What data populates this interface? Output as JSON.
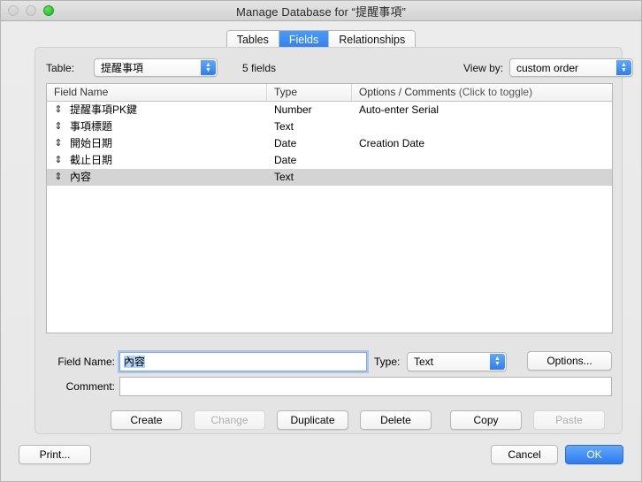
{
  "window": {
    "title": "Manage Database for “提醒事項”",
    "traffic_lights": [
      {
        "name": "close",
        "state": "disabled"
      },
      {
        "name": "minimize",
        "state": "disabled"
      },
      {
        "name": "zoom",
        "state": "enabled",
        "color": "#28c231"
      }
    ]
  },
  "tabs": [
    {
      "label": "Tables",
      "active": false
    },
    {
      "label": "Fields",
      "active": true
    },
    {
      "label": "Relationships",
      "active": false
    }
  ],
  "controls": {
    "table_label": "Table:",
    "table_value": "提醒事項",
    "field_count": "5 fields",
    "viewby_label": "View by:",
    "viewby_value": "custom order"
  },
  "list": {
    "headers": {
      "field_name": "Field Name",
      "type": "Type",
      "options": "Options / Comments",
      "options_hint": "(Click to toggle)"
    },
    "rows": [
      {
        "handle": "⇕",
        "name": "提醒事項PK鍵",
        "type": "Number",
        "options": "Auto-enter Serial",
        "selected": false
      },
      {
        "handle": "⇕",
        "name": "事項標題",
        "type": "Text",
        "options": "",
        "selected": false
      },
      {
        "handle": "⇕",
        "name": "開始日期",
        "type": "Date",
        "options": "Creation Date",
        "selected": false
      },
      {
        "handle": "⇕",
        "name": "截止日期",
        "type": "Date",
        "options": "",
        "selected": false
      },
      {
        "handle": "⇕",
        "name": "內容",
        "type": "Text",
        "options": "",
        "selected": true
      }
    ]
  },
  "form": {
    "fieldname_label": "Field Name:",
    "fieldname_value": "內容",
    "type_label": "Type:",
    "type_value": "Text",
    "options_button": "Options...",
    "comment_label": "Comment:",
    "comment_value": ""
  },
  "actions": [
    {
      "label": "Create",
      "enabled": true
    },
    {
      "label": "Change",
      "enabled": false
    },
    {
      "label": "Duplicate",
      "enabled": true
    },
    {
      "label": "Delete",
      "enabled": true
    },
    {
      "label": "Copy",
      "enabled": true
    },
    {
      "label": "Paste",
      "enabled": false
    }
  ],
  "footer": {
    "print": "Print...",
    "cancel": "Cancel",
    "ok": "OK",
    "ok_color": "#2d7bef"
  }
}
